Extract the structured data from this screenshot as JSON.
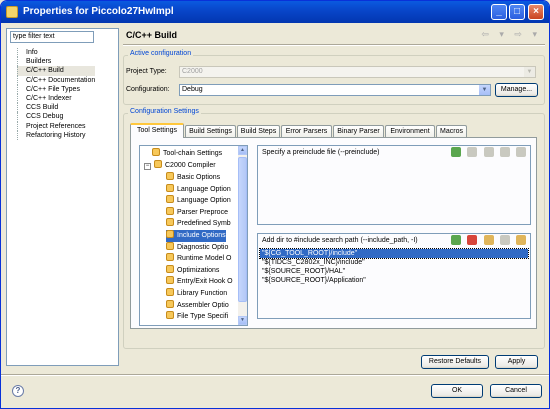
{
  "window": {
    "title": "Properties for Piccolo27HwImpl"
  },
  "left": {
    "filter_placeholder": "type filter text",
    "items": [
      "Info",
      "Builders",
      "C/C++ Build",
      "C/C++ Documentation",
      "C/C++ File Types",
      "C/C++ Indexer",
      "CCS Build",
      "CCS Debug",
      "Project References",
      "Refactoring History"
    ],
    "selected_index": 2
  },
  "header": {
    "title": "C/C++ Build",
    "nav": "⇦ ▾ ⇨ ▾"
  },
  "active_config": {
    "group_label": "Active configuration",
    "project_type_label": "Project Type:",
    "project_type_value": "C2000",
    "configuration_label": "Configuration:",
    "configuration_value": "Debug",
    "manage_label": "Manage..."
  },
  "settings": {
    "group_label": "Configuration Settings",
    "tabs": [
      "Tool Settings",
      "Build Settings",
      "Build Steps",
      "Error Parsers",
      "Binary Parser",
      "Environment",
      "Macros"
    ],
    "active_tab": 0,
    "tree": {
      "toolchain": "Tool-chain Settings",
      "compiler": "C2000 Compiler",
      "options": [
        "Basic Options",
        "Language Option",
        "Language Option",
        "Parser Preproce",
        "Predefined Symb",
        "Include Options",
        "Diagnostic Optio",
        "Runtime Model O",
        "Optimizations",
        "Entry/Exit Hook O",
        "Library Function",
        "Assembler Optio",
        "File Type Specifi"
      ],
      "selected_option": 5
    },
    "preinclude": {
      "label": "Specify a preinclude file (--preinclude)"
    },
    "include_path": {
      "label": "Add dir to #include search path (--include_path, -I)",
      "items": [
        "\"${CG_TOOL_ROOT}/include\"",
        "\"${TIDCS_C2802x_INC}/include\"",
        "\"${SOURCE_ROOT}/HAL\"",
        "\"${SOURCE_ROOT}/Application\""
      ],
      "selected_index": 0
    }
  },
  "buttons": {
    "restore_defaults": "Restore Defaults",
    "apply": "Apply",
    "ok": "OK",
    "cancel": "Cancel",
    "help": "?"
  },
  "colors": {
    "accent": "#0046d5",
    "selection": "#316ac5",
    "titlebar": "#0845c8"
  }
}
